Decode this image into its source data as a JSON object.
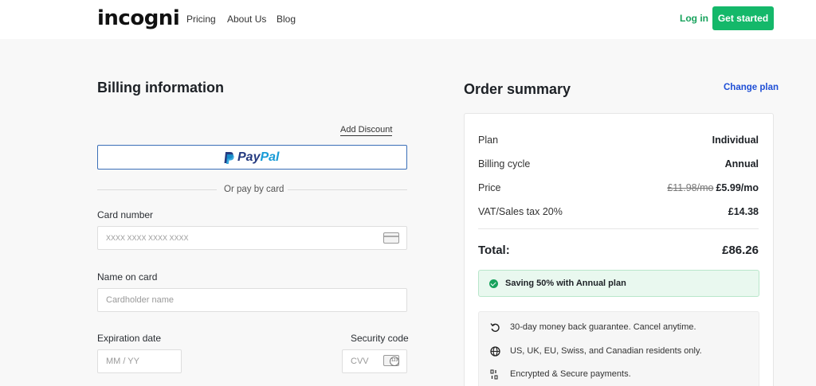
{
  "nav": {
    "logo": "incogni",
    "links": [
      "Pricing",
      "About Us",
      "Blog"
    ],
    "login": "Log in",
    "cta": "Get started"
  },
  "billing": {
    "title": "Billing information",
    "add_discount": "Add Discount",
    "paypal_pay": "Pay",
    "paypal_pal": "Pal",
    "or_text": "Or pay by card",
    "card_number_label": "Card number",
    "card_number_placeholder": "XXXX XXXX XXXX XXXX",
    "name_label": "Name on card",
    "name_placeholder": "Cardholder name",
    "expiry_label": "Expiration date",
    "expiry_placeholder": "MM / YY",
    "security_label": "Security code",
    "security_placeholder": "CVV"
  },
  "summary": {
    "title": "Order summary",
    "change_plan": "Change plan",
    "plan_label": "Plan",
    "plan_value": "Individual",
    "cycle_label": "Billing cycle",
    "cycle_value": "Annual",
    "price_label": "Price",
    "price_old": "£11.98/mo",
    "price_new": "£5.99/mo",
    "tax_label": "VAT/Sales tax 20%",
    "tax_value": "£14.38",
    "total_label": "Total:",
    "total_value": "£86.26",
    "saving": "Saving 50% with Annual plan",
    "features": [
      "30-day money back guarantee. Cancel anytime.",
      "US, UK, EU, Swiss, and Canadian residents only.",
      "Encrypted & Secure payments."
    ]
  },
  "colors": {
    "accent_green": "#14b86a",
    "link_blue": "#1f4fd6",
    "paypal_dark": "#253b80",
    "paypal_light": "#179bd7"
  }
}
